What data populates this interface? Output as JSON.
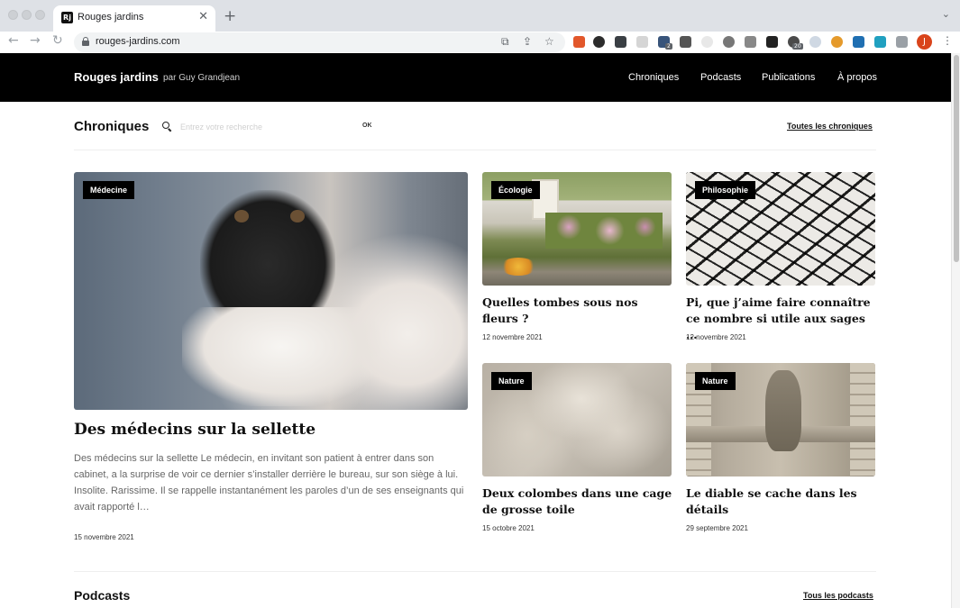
{
  "browser": {
    "tab_title": "Rouges jardins",
    "favicon_text": "Rj",
    "url": "rouges-jardins.com",
    "profile_initial": "J",
    "extension_badges": [
      "2",
      "20"
    ]
  },
  "header": {
    "brand": "Rouges jardins",
    "brand_sub": "par Guy Grandjean",
    "nav": [
      "Chroniques",
      "Podcasts",
      "Publications",
      "À propos"
    ]
  },
  "chroniques": {
    "title": "Chroniques",
    "search_placeholder": "Entrez votre recherche",
    "search_button": "OK",
    "all_link": "Toutes les chroniques",
    "featured": {
      "category": "Médecine",
      "title": "Des médecins sur la sellette",
      "excerpt": "Des médecins sur la sellette Le médecin, en invitant son patient à entrer dans son cabinet, a la surprise de voir ce dernier s’installer derrière le bureau, sur son siège à lui. Insolite. Rarissime. Il se rappelle instantanément les paroles d’un de ses enseignants qui avait rapporté l…",
      "date": "15 novembre 2021"
    },
    "cards": [
      {
        "category": "Écologie",
        "title": "Quelles tombes sous nos fleurs ?",
        "date": "12 novembre 2021"
      },
      {
        "category": "Philosophie",
        "title": "Pi, que j’aime faire connaître ce nombre si utile aux sages …",
        "date": "12 novembre 2021"
      },
      {
        "category": "Nature",
        "title": "Deux colombes dans une cage de grosse toile",
        "date": "15 octobre 2021"
      },
      {
        "category": "Nature",
        "title": "Le diable se cache dans les détails",
        "date": "29 septembre 2021"
      }
    ]
  },
  "podcasts": {
    "title": "Podcasts",
    "all_link": "Tous les podcasts"
  }
}
